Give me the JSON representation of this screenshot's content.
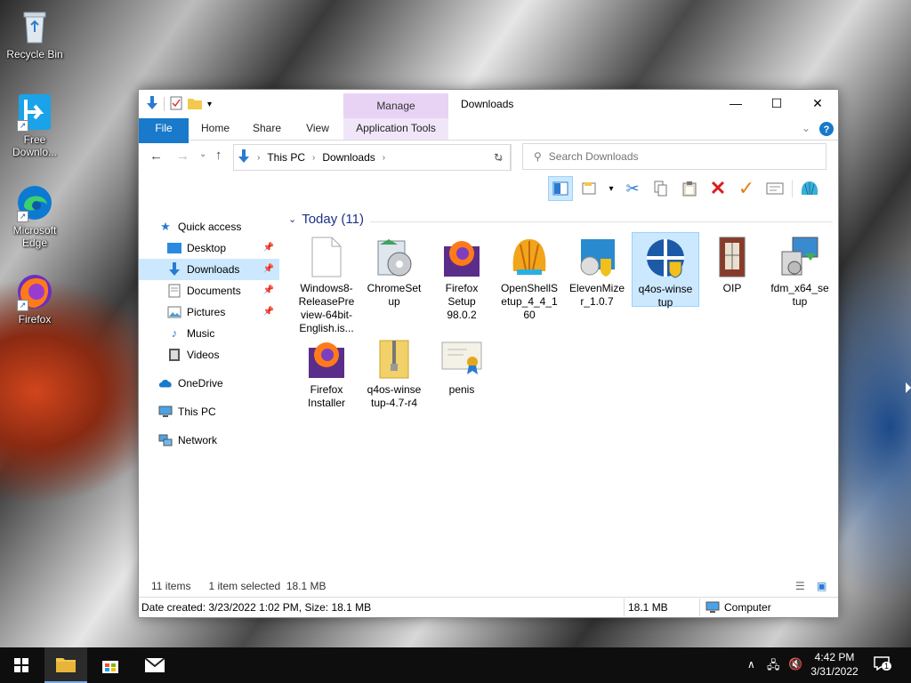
{
  "desktop": {
    "icons": [
      {
        "label": "Recycle Bin"
      },
      {
        "label": "Free Downlo..."
      },
      {
        "label": "Microsoft Edge"
      },
      {
        "label": "Firefox"
      }
    ]
  },
  "window": {
    "title": "Downloads",
    "contextual_group": "Manage",
    "tabs": {
      "file": "File",
      "home": "Home",
      "share": "Share",
      "view": "View",
      "app_tools": "Application Tools"
    },
    "controls": {
      "minimize": "—",
      "maximize": "☐",
      "close": "✕"
    }
  },
  "address": {
    "crumbs": [
      "This PC",
      "Downloads"
    ]
  },
  "search": {
    "placeholder": "Search Downloads"
  },
  "sidebar": {
    "items": [
      {
        "label": "Quick access"
      },
      {
        "label": "Desktop"
      },
      {
        "label": "Downloads"
      },
      {
        "label": "Documents"
      },
      {
        "label": "Pictures"
      },
      {
        "label": "Music"
      },
      {
        "label": "Videos"
      },
      {
        "label": "OneDrive"
      },
      {
        "label": "This PC"
      },
      {
        "label": "Network"
      }
    ]
  },
  "group": {
    "header": "Today (11)"
  },
  "files": [
    {
      "name": "Windows8-ReleasePreview-64bit-English.is...",
      "line1": "Windows8-",
      "line2": "ReleasePre",
      "line3": "view-64bit-",
      "line4": "English.is..."
    },
    {
      "name": "ChromeSetup",
      "line1": "ChromeSet",
      "line2": "up"
    },
    {
      "name": "Firefox Setup 98.0.2",
      "line1": "Firefox",
      "line2": "Setup",
      "line3": "98.0.2"
    },
    {
      "name": "OpenShellSetup_4_4_160",
      "line1": "OpenShellS",
      "line2": "etup_4_4_1",
      "line3": "60"
    },
    {
      "name": "ElevenMizer_1.0.7",
      "line1": "ElevenMize",
      "line2": "r_1.0.7"
    },
    {
      "name": "q4os-winsetup",
      "line1": "q4os-winse",
      "line2": "tup"
    },
    {
      "name": "OIP",
      "line1": "OIP"
    },
    {
      "name": "fdm_x64_setup",
      "line1": "fdm_x64_se",
      "line2": "tup"
    },
    {
      "name": "Firefox Installer",
      "line1": "Firefox",
      "line2": "Installer"
    },
    {
      "name": "q4os-winsetup-4.7-r4",
      "line1": "q4os-winse",
      "line2": "tup-4.7-r4"
    },
    {
      "name": "penis",
      "line1": "penis"
    }
  ],
  "status": {
    "count": "11 items",
    "selection": "1 item selected  18.1 MB"
  },
  "details": {
    "info": "Date created: 3/23/2022 1:02 PM, Size: 18.1 MB",
    "size": "18.1 MB",
    "location": "Computer"
  },
  "taskbar": {
    "time": "4:42 PM",
    "date": "3/31/2022",
    "notifications": "1"
  },
  "colors": {
    "accent": "#1979ca",
    "selection": "#cce8ff",
    "manage": "#e8d3f5"
  }
}
